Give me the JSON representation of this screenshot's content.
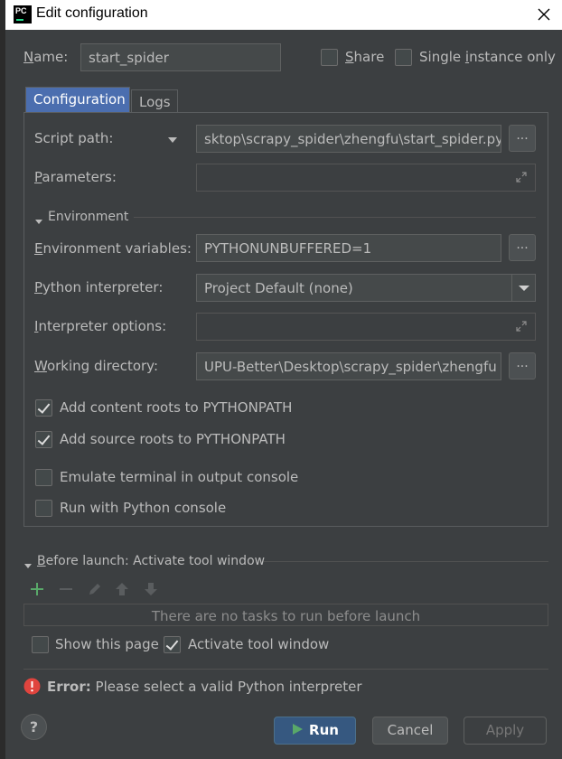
{
  "window": {
    "title": "Edit configuration",
    "app_icon_text": "PC"
  },
  "name_row": {
    "label_accel": "N",
    "label_rest": "ame:",
    "value": "start_spider",
    "share_accel": "S",
    "share_rest": "hare",
    "single_pre": "Single ",
    "single_accel": "i",
    "single_rest": "nstance only"
  },
  "tabs": [
    {
      "label": "Configuration",
      "active": true
    },
    {
      "label": "Logs",
      "active": false
    }
  ],
  "form": {
    "script_path_label": "Script path:",
    "script_path_value": "sktop\\scrapy_spider\\zhengfu\\start_spider.py",
    "parameters_accel": "P",
    "parameters_rest": "arameters:",
    "environment_section": "Environment",
    "env_vars_accel": "E",
    "env_vars_rest": "nvironment variables:",
    "env_vars_value": "PYTHONUNBUFFERED=1",
    "interpreter_accel": "P",
    "interpreter_rest": "ython interpreter:",
    "interpreter_value": "Project Default (none)",
    "interp_options_accel": "I",
    "interp_options_rest": "nterpreter options:",
    "working_dir_accel": "W",
    "working_dir_rest": "orking directory:",
    "working_dir_value": "UPU-Better\\Desktop\\scrapy_spider\\zhengfu",
    "browse_label": "..."
  },
  "options": [
    {
      "label": "Add content roots to PYTHONPATH",
      "checked": true
    },
    {
      "label": "Add source roots to PYTHONPATH",
      "checked": true
    },
    {
      "label": "Emulate terminal in output console",
      "checked": false
    },
    {
      "label": "Run with Python console",
      "checked": false
    }
  ],
  "before_launch": {
    "title_accel": "B",
    "title_rest": "efore launch: Activate tool window",
    "empty_text": "There are no tasks to run before launch",
    "show_page_label": "Show this page",
    "show_page_checked": false,
    "activate_label": "Activate tool window",
    "activate_checked": true
  },
  "error": {
    "prefix": "Error:",
    "message": "Please select a valid Python interpreter"
  },
  "buttons": {
    "help": "?",
    "run": "Run",
    "cancel": "Cancel",
    "apply": "Apply"
  },
  "colors": {
    "background": "#3c3f41",
    "accent_tab": "#4b6eaf",
    "run_button": "#365880",
    "add_icon": "#59a869",
    "error_icon": "#e0443e"
  }
}
